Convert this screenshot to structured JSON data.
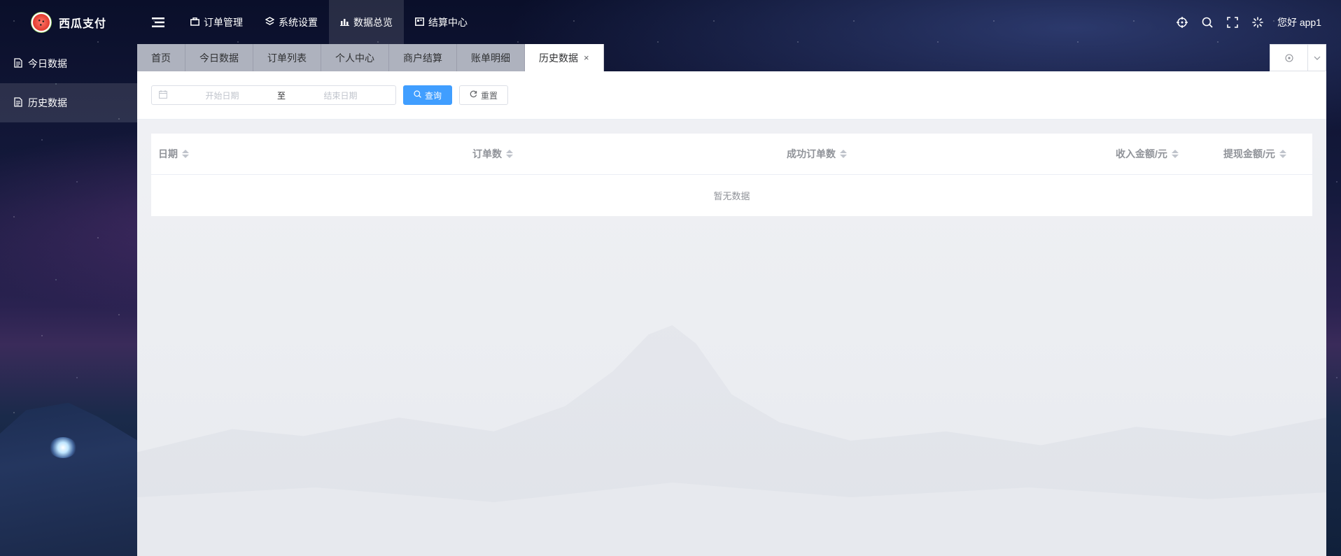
{
  "brand": {
    "name": "西瓜支付",
    "logo_icon": "watermelon-logo-icon"
  },
  "topnav": {
    "menu_icon": "hamburger-icon",
    "items": [
      {
        "label": "订单管理",
        "icon": "briefcase-icon"
      },
      {
        "label": "系统设置",
        "icon": "layers-icon"
      },
      {
        "label": "数据总览",
        "icon": "bar-chart-icon"
      },
      {
        "label": "结算中心",
        "icon": "wallet-icon"
      }
    ],
    "active_index": 2,
    "right_icons": [
      "locate-icon",
      "search-icon",
      "fullscreen-icon",
      "spinner-icon"
    ],
    "greeting": "您好 app1"
  },
  "sidebar": {
    "items": [
      {
        "label": "今日数据",
        "icon": "document-icon"
      },
      {
        "label": "历史数据",
        "icon": "document-icon"
      }
    ],
    "active_index": 1
  },
  "tabs": {
    "items": [
      "首页",
      "今日数据",
      "订单列表",
      "个人中心",
      "商户结算",
      "账单明细",
      "历史数据"
    ],
    "active_label": "历史数据",
    "close_glyph": "×"
  },
  "filter": {
    "start_placeholder": "开始日期",
    "separator": "至",
    "end_placeholder": "结束日期",
    "query_label": "查询",
    "reset_label": "重置"
  },
  "table": {
    "columns": [
      "日期",
      "订单数",
      "成功订单数",
      "收入金额/元",
      "提现金额/元"
    ],
    "empty_text": "暂无数据"
  },
  "colors": {
    "primary": "#409eff",
    "tab_bg": "#d2d6de",
    "content_bg": "#eceef2"
  }
}
